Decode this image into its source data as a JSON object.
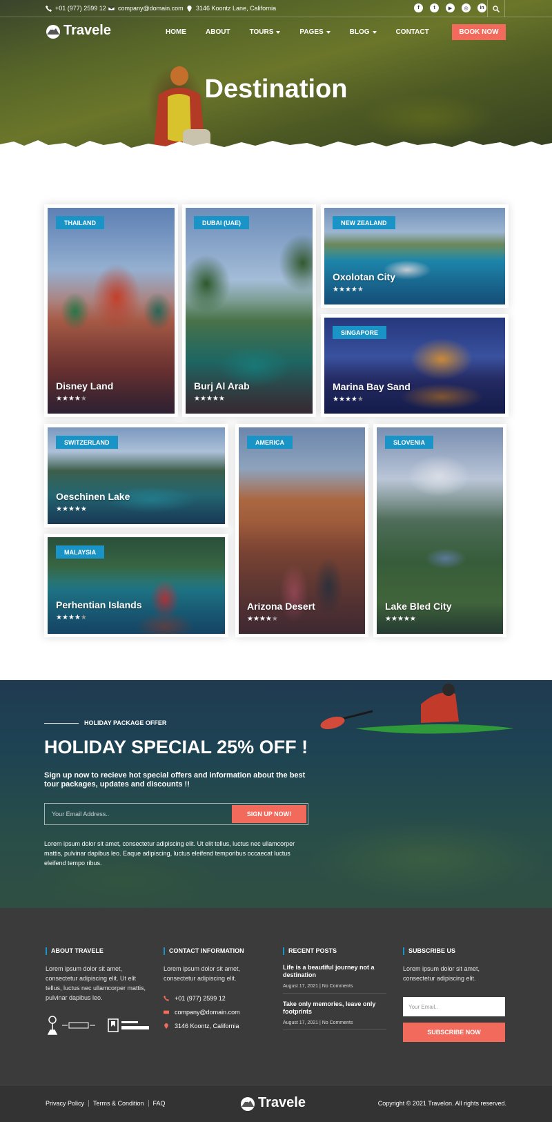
{
  "topbar": {
    "phone": "+01 (977) 2599 12",
    "email": "company@domain.com",
    "address": "3146 Koontz Lane, California",
    "social": [
      "facebook-icon",
      "twitter-icon",
      "youtube-icon",
      "instagram-icon",
      "linkedin-icon"
    ]
  },
  "nav": {
    "brand": "Travele",
    "items": [
      "HOME",
      "ABOUT",
      "TOURS",
      "PAGES",
      "BLOG",
      "CONTACT"
    ],
    "book_label": "BOOK NOW"
  },
  "hero": {
    "title": "Destination"
  },
  "destinations": [
    {
      "tag": "THAILAND",
      "name": "Disney Land",
      "rating": 4,
      "stars": "★★★★★"
    },
    {
      "tag": "DUBAI (UAE)",
      "name": "Burj Al Arab",
      "rating": 5,
      "stars": "★★★★★"
    },
    {
      "tag": "NEW ZEALAND",
      "name": "Oxolotan City",
      "rating": 4.5,
      "stars": "★★★★★"
    },
    {
      "tag": "SINGAPORE",
      "name": "Marina Bay Sand",
      "rating": 4,
      "stars": "★★★★★"
    },
    {
      "tag": "SWITZERLAND",
      "name": "Oeschinen Lake",
      "rating": 5,
      "stars": "★★★★★"
    },
    {
      "tag": "AMERICA",
      "name": "Arizona Desert",
      "rating": 4,
      "stars": "★★★★★"
    },
    {
      "tag": "SLOVENIA",
      "name": "Lake Bled City",
      "rating": 5,
      "stars": "★★★★★"
    },
    {
      "tag": "MALAYSIA",
      "name": "Perhentian Islands",
      "rating": 4,
      "stars": "★★★★★"
    }
  ],
  "offer": {
    "kicker": "HOLIDAY PACKAGE OFFER",
    "title": "HOLIDAY SPECIAL 25% OFF !",
    "subtitle": "Sign up now to recieve hot special offers and information about the best tour packages, updates and discounts !!",
    "email_placeholder": "Your Email Address..",
    "button": "SIGN UP NOW!",
    "text": "Lorem ipsum dolor sit amet, consectetur adipiscing elit. Ut elit tellus, luctus nec ullamcorper mattis, pulvinar dapibus leo. Eaque adipiscing, luctus eleifend temporibus occaecat luctus eleifend tempo ribus."
  },
  "footer": {
    "about": {
      "heading": "ABOUT TRAVELE",
      "text": "Lorem ipsum dolor sit amet, consectetur adipiscing elit. Ut elit tellus, luctus nec ullamcorper mattis, pulvinar dapibus leo."
    },
    "contact": {
      "heading": "CONTACT INFORMATION",
      "text": "Lorem ipsum dolor sit amet, consectetur adipiscing elit.",
      "phone": "+01 (977) 2599 12",
      "email": "company@domain.com",
      "address": "3146 Koontz, California"
    },
    "posts": {
      "heading": "RECENT POSTS",
      "items": [
        {
          "title": "Life is a beautiful journey not a destination",
          "date": "August 17, 2021",
          "comments": "No Comments"
        },
        {
          "title": "Take only memories, leave only footprints",
          "date": "August 17, 2021",
          "comments": "No Comments"
        }
      ]
    },
    "subscribe": {
      "heading": "SUBSCRIBE US",
      "text": "Lorem ipsum dolor sit amet, consectetur adipiscing elit.",
      "placeholder": "Your Email..",
      "button": "SUBSCRIBE NOW"
    },
    "links": [
      "Privacy Policy",
      "Terms & Condition",
      "FAQ"
    ],
    "brand": "Travele",
    "copyright": "Copyright © 2021 Travelon. All rights reserved."
  },
  "colors": {
    "accent": "#f16a5c",
    "tag": "#1a93c6",
    "footer": "#3b3b3b"
  }
}
